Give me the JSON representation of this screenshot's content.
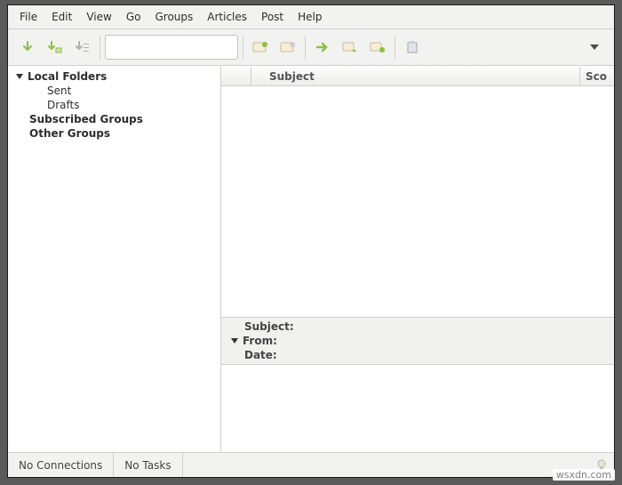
{
  "menu": {
    "file": "File",
    "edit": "Edit",
    "view": "View",
    "go": "Go",
    "groups": "Groups",
    "articles": "Articles",
    "post": "Post",
    "help": "Help"
  },
  "search": {
    "placeholder": ""
  },
  "sidebar": {
    "items": [
      {
        "label": "Local Folders",
        "expanded": true,
        "bold": true
      },
      {
        "label": "Sent"
      },
      {
        "label": "Drafts"
      },
      {
        "label": "Subscribed Groups",
        "bold": true
      },
      {
        "label": "Other Groups",
        "bold": true
      }
    ]
  },
  "columns": {
    "subject": "Subject",
    "score": "Sco"
  },
  "message_header": {
    "subject_label": "Subject:",
    "from_label": "From:",
    "date_label": "Date:"
  },
  "status": {
    "connections": "No Connections",
    "tasks": "No Tasks"
  },
  "watermark": "wsxdn.com"
}
